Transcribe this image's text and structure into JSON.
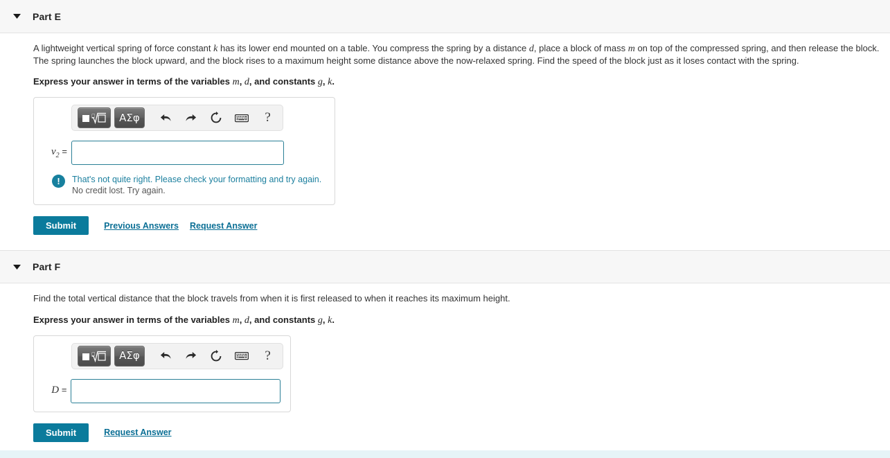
{
  "parts": [
    {
      "id": "part-e",
      "title": "Part E",
      "caret_icon": "caret-down-icon",
      "prompt_segments": [
        {
          "t": "A lightweight vertical spring of force constant ",
          "v": false
        },
        {
          "t": "k",
          "v": true
        },
        {
          "t": " has its lower end mounted on a table. You compress the spring by a distance ",
          "v": false
        },
        {
          "t": "d",
          "v": true
        },
        {
          "t": ", place a block of mass ",
          "v": false
        },
        {
          "t": "m",
          "v": true
        },
        {
          "t": " on top of the compressed spring, and then release the block. The spring launches the block upward, and the block rises to a maximum height some distance above the now-relaxed spring. Find the speed of the block just as it loses contact with the spring.",
          "v": false
        }
      ],
      "express_segments": [
        {
          "t": "Express your answer in terms of the variables ",
          "v": false
        },
        {
          "t": "m",
          "v": true
        },
        {
          "t": ", ",
          "v": false
        },
        {
          "t": "d",
          "v": true
        },
        {
          "t": ", and constants ",
          "v": false
        },
        {
          "t": "g",
          "v": true
        },
        {
          "t": ", ",
          "v": false
        },
        {
          "t": "k",
          "v": true
        },
        {
          "t": ".",
          "v": false
        }
      ],
      "toolbar": {
        "template_button_label": "template-button",
        "template_icon": "nth-root-icon",
        "greek_button_label": "ΑΣφ",
        "undo_icon": "undo-arrow-icon",
        "redo_icon": "redo-arrow-icon",
        "reset_icon": "reset-circular-arrow-icon",
        "keyboard_icon": "keyboard-icon",
        "help_label": "?"
      },
      "answer": {
        "label_var": "v",
        "label_sub": "2",
        "label_eq": "=",
        "value": "",
        "placeholder": ""
      },
      "feedback": {
        "icon": "exclamation-circle-icon",
        "line1": "That's not quite right. Please check your formatting and try again.",
        "line2": "No credit lost. Try again."
      },
      "actions": {
        "submit_label": "Submit",
        "links": [
          "Previous Answers",
          "Request Answer"
        ]
      }
    },
    {
      "id": "part-f",
      "title": "Part F",
      "caret_icon": "caret-down-icon",
      "prompt_segments": [
        {
          "t": "Find the total vertical distance that the block travels from when it is first released to when it reaches its maximum height.",
          "v": false
        }
      ],
      "express_segments": [
        {
          "t": "Express your answer in terms of the variables ",
          "v": false
        },
        {
          "t": "m",
          "v": true
        },
        {
          "t": ", ",
          "v": false
        },
        {
          "t": "d",
          "v": true
        },
        {
          "t": ", and constants ",
          "v": false
        },
        {
          "t": "g",
          "v": true
        },
        {
          "t": ", ",
          "v": false
        },
        {
          "t": "k",
          "v": true
        },
        {
          "t": ".",
          "v": false
        }
      ],
      "toolbar": {
        "template_button_label": "template-button",
        "template_icon": "nth-root-icon",
        "greek_button_label": "ΑΣφ",
        "undo_icon": "undo-arrow-icon",
        "redo_icon": "redo-arrow-icon",
        "reset_icon": "reset-circular-arrow-icon",
        "keyboard_icon": "keyboard-icon",
        "help_label": "?"
      },
      "answer": {
        "label_var": "D",
        "label_sub": "",
        "label_eq": "=",
        "value": "",
        "placeholder": ""
      },
      "feedback": null,
      "actions": {
        "submit_label": "Submit",
        "links": [
          "Request Answer"
        ]
      }
    }
  ],
  "colors": {
    "accent": "#0b7b9c",
    "link": "#0b6f95",
    "feedback_icon": "#17809e",
    "input_border": "#2a7f96",
    "header_bg": "#f7f7f7",
    "bottom_strip": "#e6f4f7"
  }
}
